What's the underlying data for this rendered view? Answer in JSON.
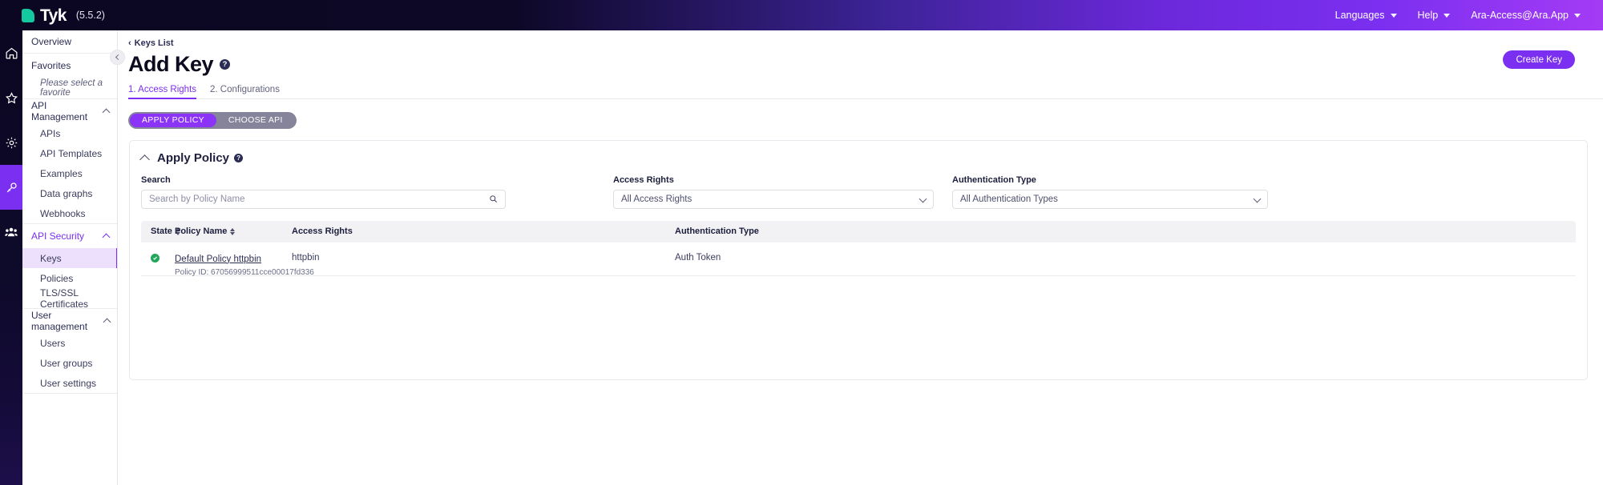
{
  "topbar": {
    "brand": "Tyk",
    "version": "(5.5.2)",
    "languages": "Languages",
    "help": "Help",
    "account": "Ara-Access@Ara.App"
  },
  "rail": {
    "items": [
      {
        "name": "home-icon",
        "active": false
      },
      {
        "name": "star-icon",
        "active": false
      },
      {
        "name": "gear-icon",
        "active": false
      },
      {
        "name": "key-icon",
        "active": true
      },
      {
        "name": "users-icon",
        "active": false
      }
    ]
  },
  "sidebar": {
    "overview": "Overview",
    "favorites": "Favorites",
    "favorites_note": "Please select a favorite",
    "groups": [
      {
        "label": "API Management",
        "items": [
          "APIs",
          "API Templates",
          "Examples",
          "Data graphs",
          "Webhooks"
        ]
      },
      {
        "label": "API Security",
        "items": [
          "Keys",
          "Policies",
          "TLS/SSL Certificates"
        ]
      },
      {
        "label": "User management",
        "items": [
          "Users",
          "User groups",
          "User settings"
        ]
      }
    ],
    "active_item": "Keys",
    "active_group": "API Security"
  },
  "main": {
    "breadcrumb": "Keys List",
    "breadcrumb_arrow": "‹",
    "title": "Add Key",
    "help_glyph": "?",
    "create_button": "Create Key",
    "tabs": [
      {
        "label": "1. Access Rights",
        "active": true
      },
      {
        "label": "2. Configurations",
        "active": false
      }
    ],
    "segment": [
      {
        "label": "APPLY POLICY",
        "active": true
      },
      {
        "label": "CHOOSE API",
        "active": false
      }
    ],
    "card": {
      "title": "Apply Policy",
      "filters": {
        "search_label": "Search",
        "search_value": "",
        "search_placeholder": "Search by Policy Name",
        "access_label": "Access Rights",
        "access_value": "All Access Rights",
        "auth_label": "Authentication Type",
        "auth_value": "All Authentication Types"
      },
      "table": {
        "columns": [
          "State",
          "Policy Name",
          "Access Rights",
          "Authentication Type"
        ],
        "rows": [
          {
            "state": "selected",
            "policy_name": "Default Policy httpbin",
            "policy_id": "Policy ID: 67056999511cce00017fd336",
            "access_rights": "httpbin",
            "auth_type": "Auth Token"
          }
        ]
      }
    }
  },
  "colors": {
    "accent": "#7b2ff0",
    "brand_teal": "#14c8a0",
    "dark": "#0b0722",
    "success": "#22a75a"
  }
}
